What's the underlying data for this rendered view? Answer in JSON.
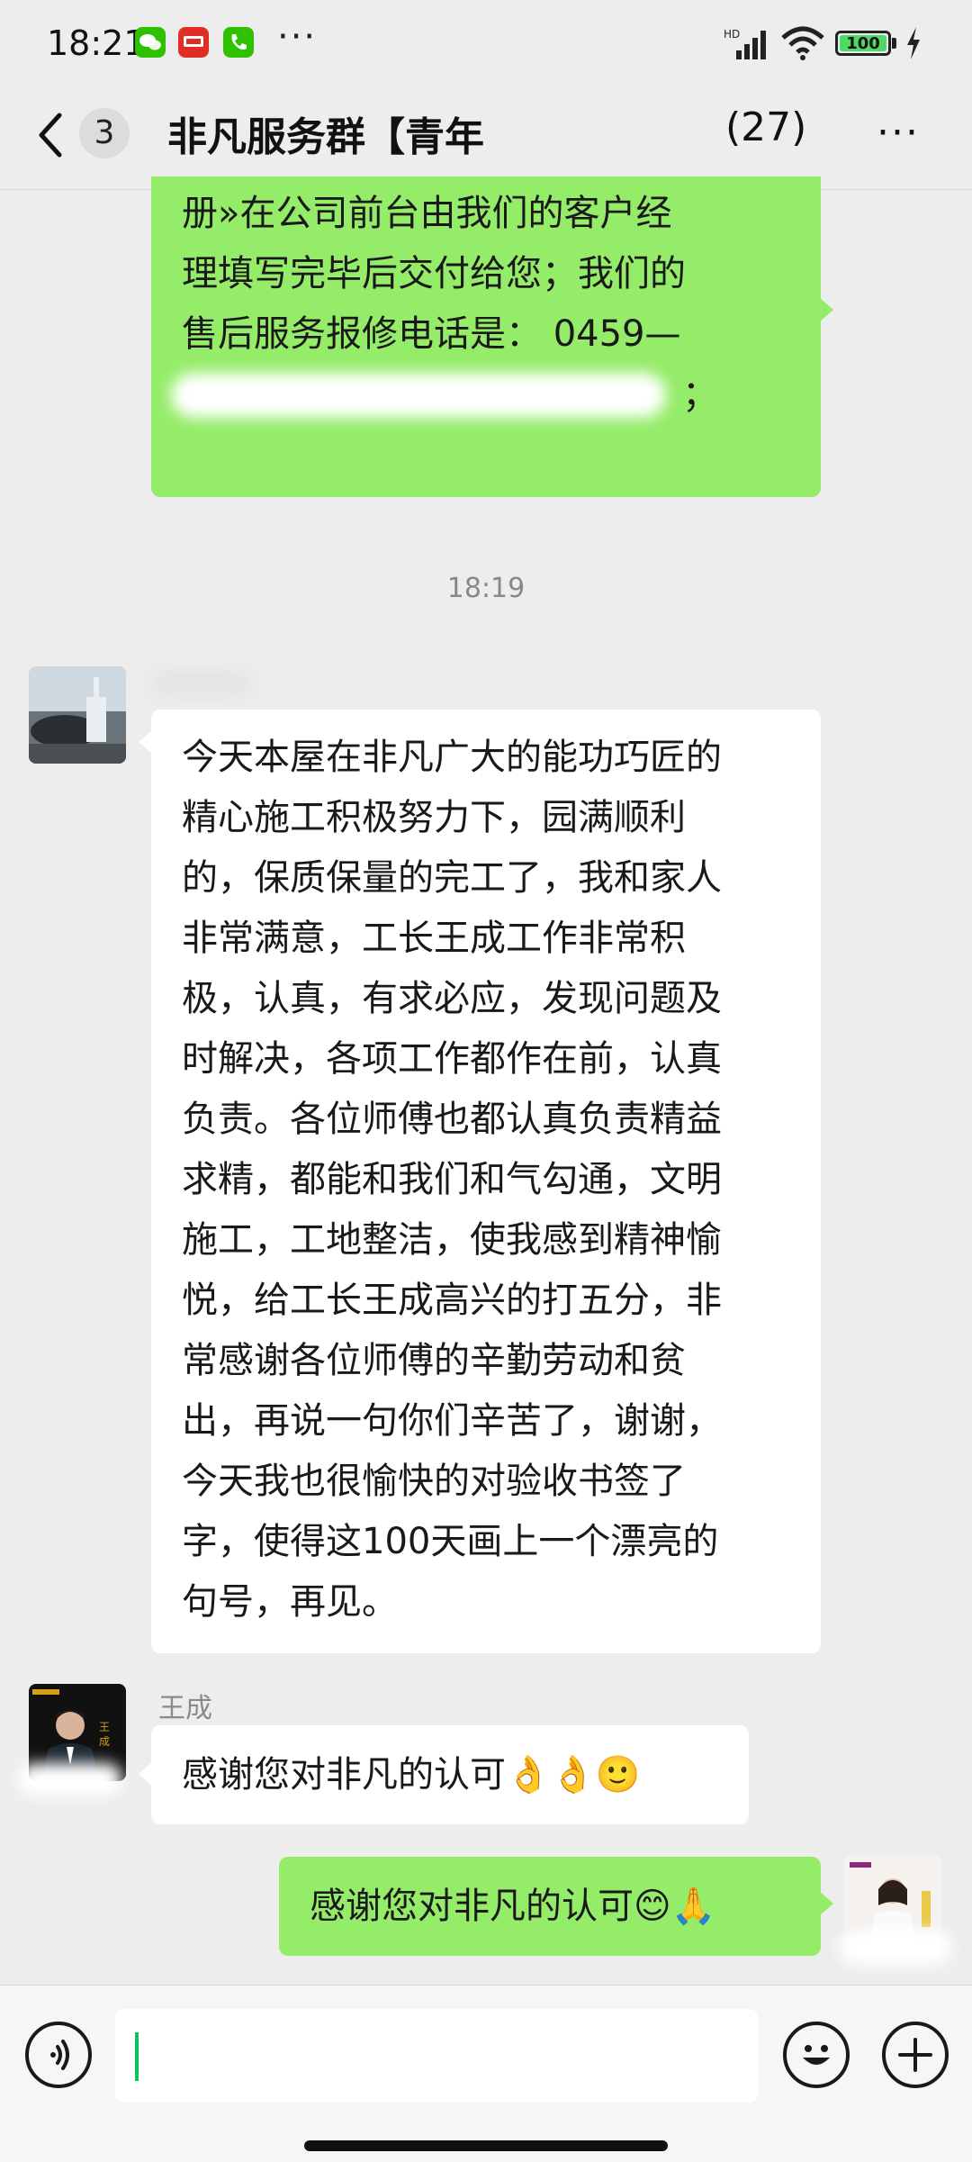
{
  "status_bar": {
    "time": "18:21",
    "battery": "100",
    "network": "HD"
  },
  "header": {
    "back_label": "3",
    "title": "非凡服务群【青年",
    "member_count": "(27)"
  },
  "messages": [
    {
      "side": "right",
      "lines": [
        "册»在公司前台由我们的客户经",
        "理填写完毕后交付给您；我们的",
        "售后服务报修电话是： 0459—",
        "；"
      ]
    },
    {
      "type": "timestamp",
      "text": "18:19"
    },
    {
      "side": "left",
      "lines": [
        "今天本屋在非凡广大的能功巧匠的",
        "精心施工积极努力下，园满顺利",
        "的，保质保量的完工了，我和家人",
        "非常满意，工长王成工作非常积",
        "极，认真，有求必应，发现问题及",
        "时解决，各项工作都作在前，认真",
        "负责。各位师傅也都认真负责精益",
        "求精，都能和我们和气勾通，文明",
        "施工，工地整洁，使我感到精神愉",
        "悦，给工长王成高兴的打五分，非",
        "常感谢各位师傅的辛勤劳动和贫",
        "出，再说一句你们辛苦了，谢谢，",
        "今天我也很愉快的对验收书签了",
        "字，使得这100天画上一个漂亮的",
        "句号，再见。"
      ]
    },
    {
      "side": "left",
      "sender": "王成",
      "text": "感谢您对非凡的认可",
      "emoji": "👌👌🙂"
    },
    {
      "side": "right",
      "text": "感谢您对非凡的认可",
      "emoji": "😊🙏"
    }
  ],
  "colors": {
    "bubble_self": "#95ec69",
    "bubble_other": "#ffffff",
    "background": "#ededed",
    "accent": "#07c160"
  },
  "icons": [
    "wechat-icon",
    "news-app-icon",
    "phone-icon",
    "voice-icon",
    "emoji-icon",
    "plus-icon",
    "back-icon",
    "more-icon"
  ]
}
